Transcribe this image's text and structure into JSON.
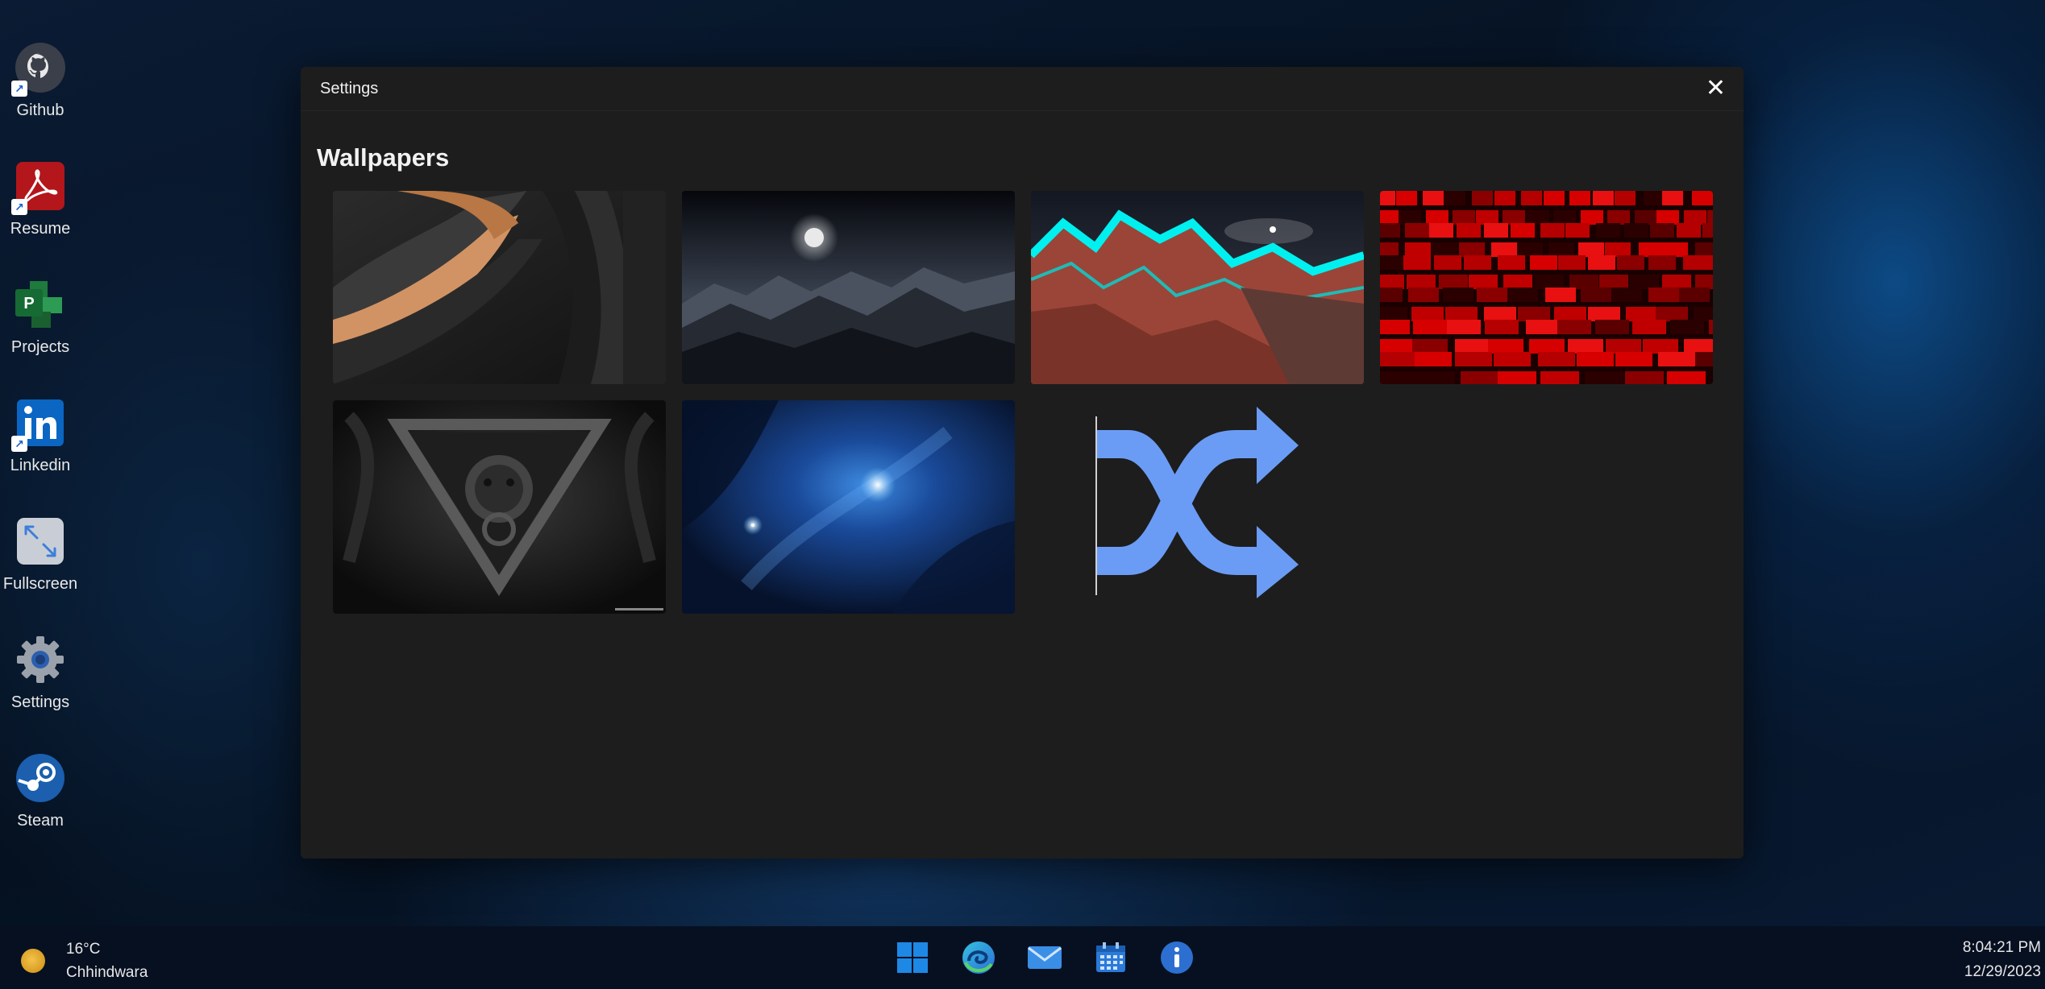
{
  "desktop": {
    "icons": [
      {
        "label": "Github",
        "icon": "github-icon"
      },
      {
        "label": "Resume",
        "icon": "pdf-icon"
      },
      {
        "label": "Projects",
        "icon": "project-icon"
      },
      {
        "label": "Linkedin",
        "icon": "linkedin-icon"
      },
      {
        "label": "Fullscreen",
        "icon": "fullscreen-icon"
      },
      {
        "label": "Settings",
        "icon": "gear-icon"
      },
      {
        "label": "Steam",
        "icon": "steam-icon"
      }
    ]
  },
  "window": {
    "title": "Settings",
    "close_glyph": "✕",
    "section_title": "Wallpapers",
    "wallpapers": [
      {
        "name": "black-orange-waves",
        "colors": [
          "#1a1a1a",
          "#c8875a"
        ]
      },
      {
        "name": "moonlit-mountains",
        "colors": [
          "#0b0f18",
          "#6b7482"
        ]
      },
      {
        "name": "neon-cyan-mountain",
        "colors": [
          "#00e5e5",
          "#a2473a"
        ]
      },
      {
        "name": "red-cubes",
        "colors": [
          "#1a0000",
          "#d10000"
        ]
      },
      {
        "name": "lion-door-knocker",
        "colors": [
          "#0f0f0f",
          "#555555"
        ]
      },
      {
        "name": "blue-nebula",
        "colors": [
          "#0a1a3a",
          "#2a7bd6"
        ]
      }
    ],
    "shuffle": {
      "icon": "shuffle-icon",
      "color": "#6b9cf5"
    }
  },
  "taskbar": {
    "weather": {
      "temperature": "16°C",
      "location": "Chhindwara",
      "icon": "sun-icon"
    },
    "apps": [
      {
        "name": "start",
        "icon": "windows-icon"
      },
      {
        "name": "edge",
        "icon": "edge-icon"
      },
      {
        "name": "mail",
        "icon": "mail-icon"
      },
      {
        "name": "calendar",
        "icon": "calendar-icon"
      },
      {
        "name": "info",
        "icon": "info-icon"
      }
    ],
    "clock": {
      "time": "8:04:21 PM",
      "date": "12/29/2023"
    }
  }
}
